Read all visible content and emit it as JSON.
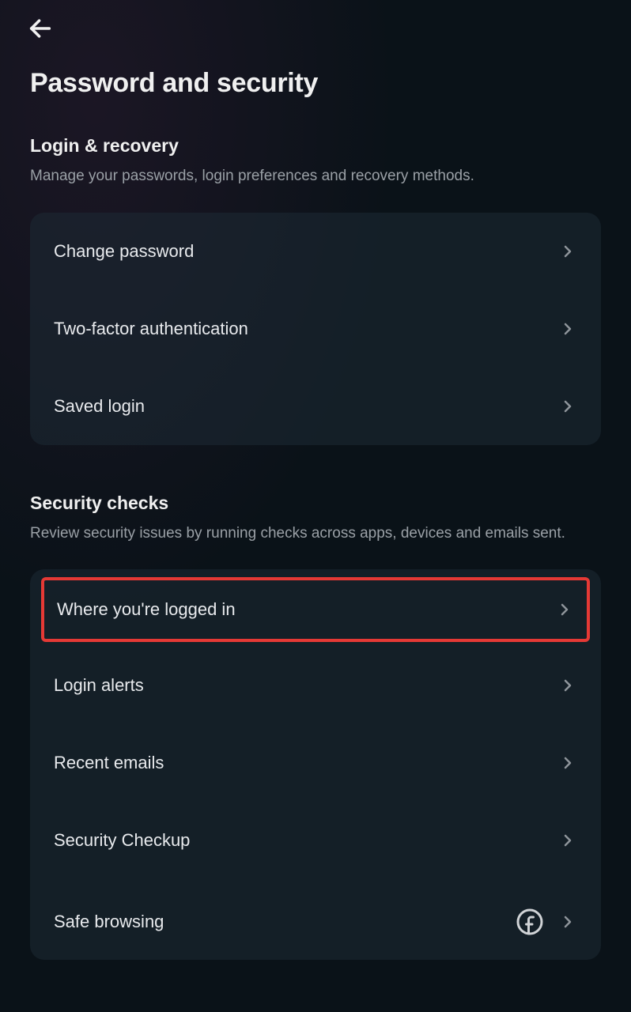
{
  "header": {
    "pageTitle": "Password and security"
  },
  "sections": {
    "login": {
      "title": "Login & recovery",
      "desc": "Manage your passwords, login preferences and recovery methods.",
      "items": [
        {
          "label": "Change password"
        },
        {
          "label": "Two-factor authentication"
        },
        {
          "label": "Saved login"
        }
      ]
    },
    "security": {
      "title": "Security checks",
      "desc": "Review security issues by running checks across apps, devices and emails sent.",
      "items": [
        {
          "label": "Where you're logged in"
        },
        {
          "label": "Login alerts"
        },
        {
          "label": "Recent emails"
        },
        {
          "label": "Security Checkup"
        },
        {
          "label": "Safe browsing"
        }
      ]
    }
  }
}
